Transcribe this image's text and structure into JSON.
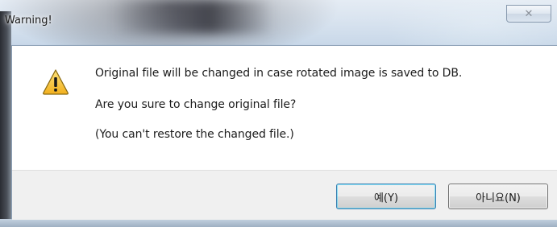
{
  "window": {
    "title": "Warning!",
    "close_icon": "close-icon"
  },
  "dialog": {
    "icon": "warning-icon",
    "icon_colors": {
      "fill": "#f6c02a",
      "border": "#8a6a10",
      "glyph": "#1a1a1a"
    },
    "messages": [
      "Original file will be changed in case rotated image is saved to DB.",
      "Are you sure to change original file?",
      "(You can't restore the changed file.)"
    ]
  },
  "buttons": {
    "yes_label": "예(Y)",
    "no_label": "아니요(N)"
  }
}
